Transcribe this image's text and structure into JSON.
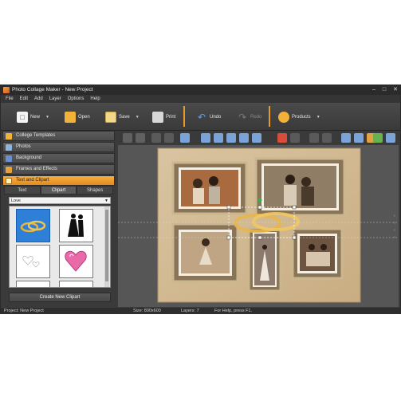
{
  "window": {
    "title": "Photo Collage Maker - New Project"
  },
  "menu": [
    "File",
    "Edit",
    "Add",
    "Layer",
    "Options",
    "Help"
  ],
  "ribbon": {
    "new_label": "New",
    "open_label": "Open",
    "save_label": "Save",
    "print_label": "Print",
    "undo_label": "Undo",
    "redo_label": "Redo",
    "products_label": "Products"
  },
  "left_panel": {
    "sections": [
      "College Templates",
      "Photos",
      "Background",
      "Frames and Effects",
      "Text and Clipart"
    ],
    "active_section": "Text and Clipart",
    "tabs": [
      "Text",
      "Clipart",
      "Shapes"
    ],
    "selected_tab": "Clipart",
    "category": "Love",
    "create_button": "Create New Clipart"
  },
  "status": {
    "project": "Project: New Project",
    "size": "Size: 800x600",
    "layers": "Layers: 7",
    "help": "For Help, press F1."
  },
  "colors": {
    "accent": "#e48a1c",
    "selection": "#2d7fd8",
    "canvas_bg": "#d8c3a0"
  }
}
